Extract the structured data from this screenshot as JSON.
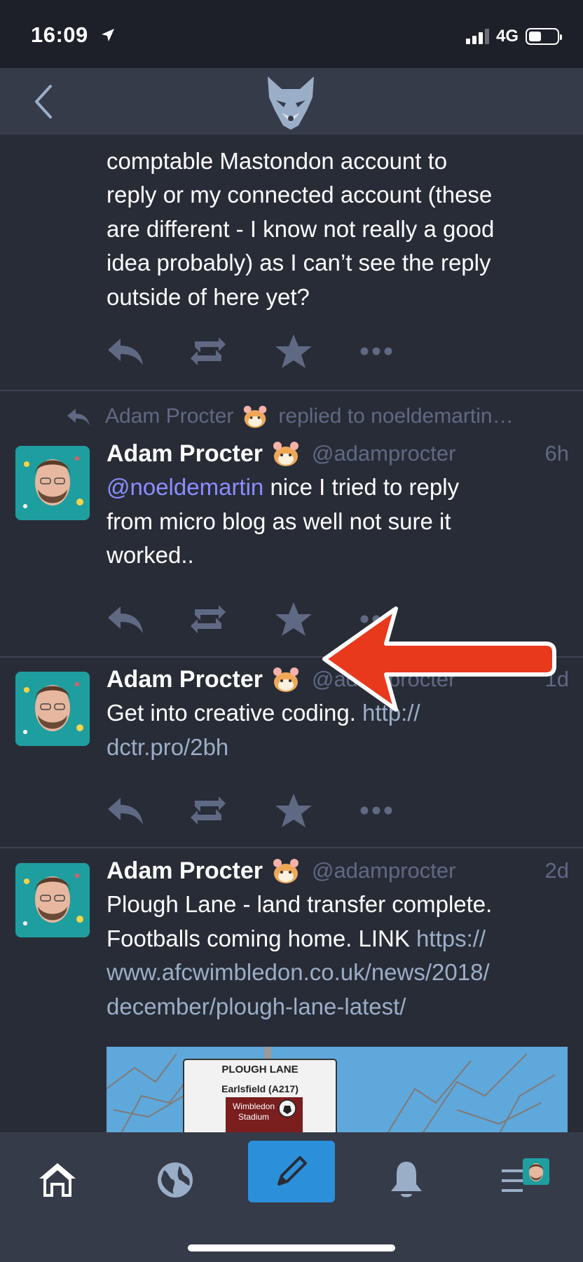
{
  "status_bar": {
    "time": "16:09",
    "network": "4G"
  },
  "posts": {
    "p0": {
      "lines": [
        "comptable Mastondon account to",
        "reply or my connected account (these",
        "are different - I know not really a good",
        "idea probably) as I can’t see the reply",
        "outside of here yet?"
      ]
    },
    "p1": {
      "reply_indicator": "replied to noeldemartin…",
      "reply_indicator_name": "Adam Procter",
      "display_name": "Adam Procter",
      "handle": "@adamprocter",
      "time": "6h",
      "mention": "@noeldemartin",
      "line1_rest": " nice I tried to reply",
      "line2": "from micro blog as well not sure it",
      "line3": "worked.."
    },
    "p2": {
      "display_name": "Adam Procter",
      "handle": "@adamprocter",
      "time": "1d",
      "line1_text": "Get into creative coding. ",
      "line1_link": "http://",
      "line2_link": "dctr.pro/2bh"
    },
    "p3": {
      "display_name": "Adam Procter",
      "handle": "@adamprocter",
      "time": "2d",
      "line1": "Plough Lane - land transfer complete.",
      "line2_text": "Footballs coming home. LINK ",
      "line2_link": "https://",
      "line3_link": "www.afcwimbledon.co.uk/news/2018/",
      "line4_link": "december/plough-lane-latest/",
      "image_sign": {
        "title": "PLOUGH LANE",
        "line2": "Earlsfield (A217)",
        "line3": "Wimbledon",
        "line4": "Stadium"
      }
    }
  },
  "colors": {
    "background": "#282c37",
    "nav": "#363b4a",
    "muted": "#606984",
    "link": "#8c8dff",
    "accent": "#2b90d9",
    "arrow": "#e8391d"
  },
  "icons": [
    "back-icon",
    "mastodon-logo",
    "reply-icon",
    "boost-icon",
    "favourite-icon",
    "more-icon",
    "home-icon",
    "globe-icon",
    "compose-icon",
    "bell-icon",
    "menu-icon"
  ]
}
